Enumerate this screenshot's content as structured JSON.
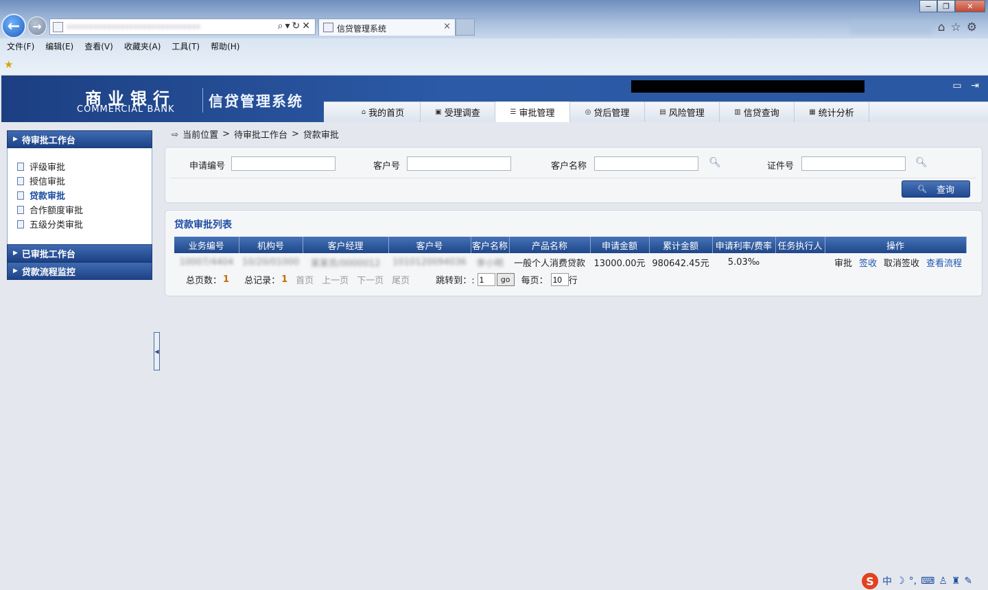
{
  "browser": {
    "tab_title": "信贷管理系统",
    "tab_close": "×",
    "menu": [
      "文件(F)",
      "编辑(E)",
      "查看(V)",
      "收藏夹(A)",
      "工具(T)",
      "帮助(H)"
    ],
    "window_controls": {
      "minimize": "−",
      "restore": "❐",
      "close": "✕"
    },
    "back_icon": "←",
    "forward_icon": "→"
  },
  "header": {
    "logo_cn": "商业银行",
    "logo_en": "COMMERCIAL BANK",
    "system_title": "信贷管理系统",
    "nav_tabs": [
      {
        "label": "我的首页",
        "icon": "home-icon"
      },
      {
        "label": "受理调查",
        "icon": "survey-icon"
      },
      {
        "label": "审批管理",
        "icon": "approval-icon",
        "active": true
      },
      {
        "label": "贷后管理",
        "icon": "postloan-icon"
      },
      {
        "label": "风险管理",
        "icon": "risk-icon"
      },
      {
        "label": "信贷查询",
        "icon": "query-icon"
      },
      {
        "label": "统计分析",
        "icon": "stats-icon"
      }
    ]
  },
  "sidebar": {
    "section1": "待审批工作台",
    "items": [
      "评级审批",
      "授信审批",
      "贷款审批",
      "合作额度审批",
      "五级分类审批"
    ],
    "active_index": 2,
    "section2": "已审批工作台",
    "section3": "贷款流程监控"
  },
  "breadcrumb": {
    "prefix": "当前位置",
    "sep": ">",
    "level1": "待审批工作台",
    "level2": "贷款审批"
  },
  "search": {
    "app_no_label": "申请编号",
    "cust_no_label": "客户号",
    "cust_name_label": "客户名称",
    "cert_no_label": "证件号",
    "app_no_value": "",
    "cust_no_value": "",
    "cust_name_value": "",
    "cert_no_value": "",
    "query_button": "查询"
  },
  "list": {
    "title": "贷款审批列表",
    "columns": [
      "业务编号",
      "机构号",
      "客户经理",
      "客户号",
      "客户名称",
      "产品名称",
      "申请金额",
      "累计金额",
      "申请利率/费率",
      "任务执行人",
      "操作"
    ],
    "rows": [
      {
        "biz_no": "10007/4404",
        "org_no": "10/20/01000",
        "manager": "某某员/0000012",
        "cust_no": "1010120094036",
        "cust_name": "李小明",
        "product": "一般个人消费贷款",
        "apply_amount": "13000.00元",
        "total_amount": "980642.45元",
        "rate": "5.03‰",
        "executor": "",
        "actions": [
          "审批",
          "签收",
          "取消签收",
          "查看流程"
        ]
      }
    ]
  },
  "pager": {
    "total_pages_label": "总页数：",
    "total_pages": "1",
    "total_records_label": "总记录：",
    "total_records": "1",
    "first": "首页",
    "prev": "上一页",
    "next": "下一页",
    "last": "尾页",
    "jump_label": "跳转到：:",
    "jump_value": "1",
    "go": "go",
    "per_page_label": "每页：",
    "per_page": "10",
    "per_page_unit": "行"
  },
  "ime": {
    "logo": "S",
    "mode": "中"
  }
}
